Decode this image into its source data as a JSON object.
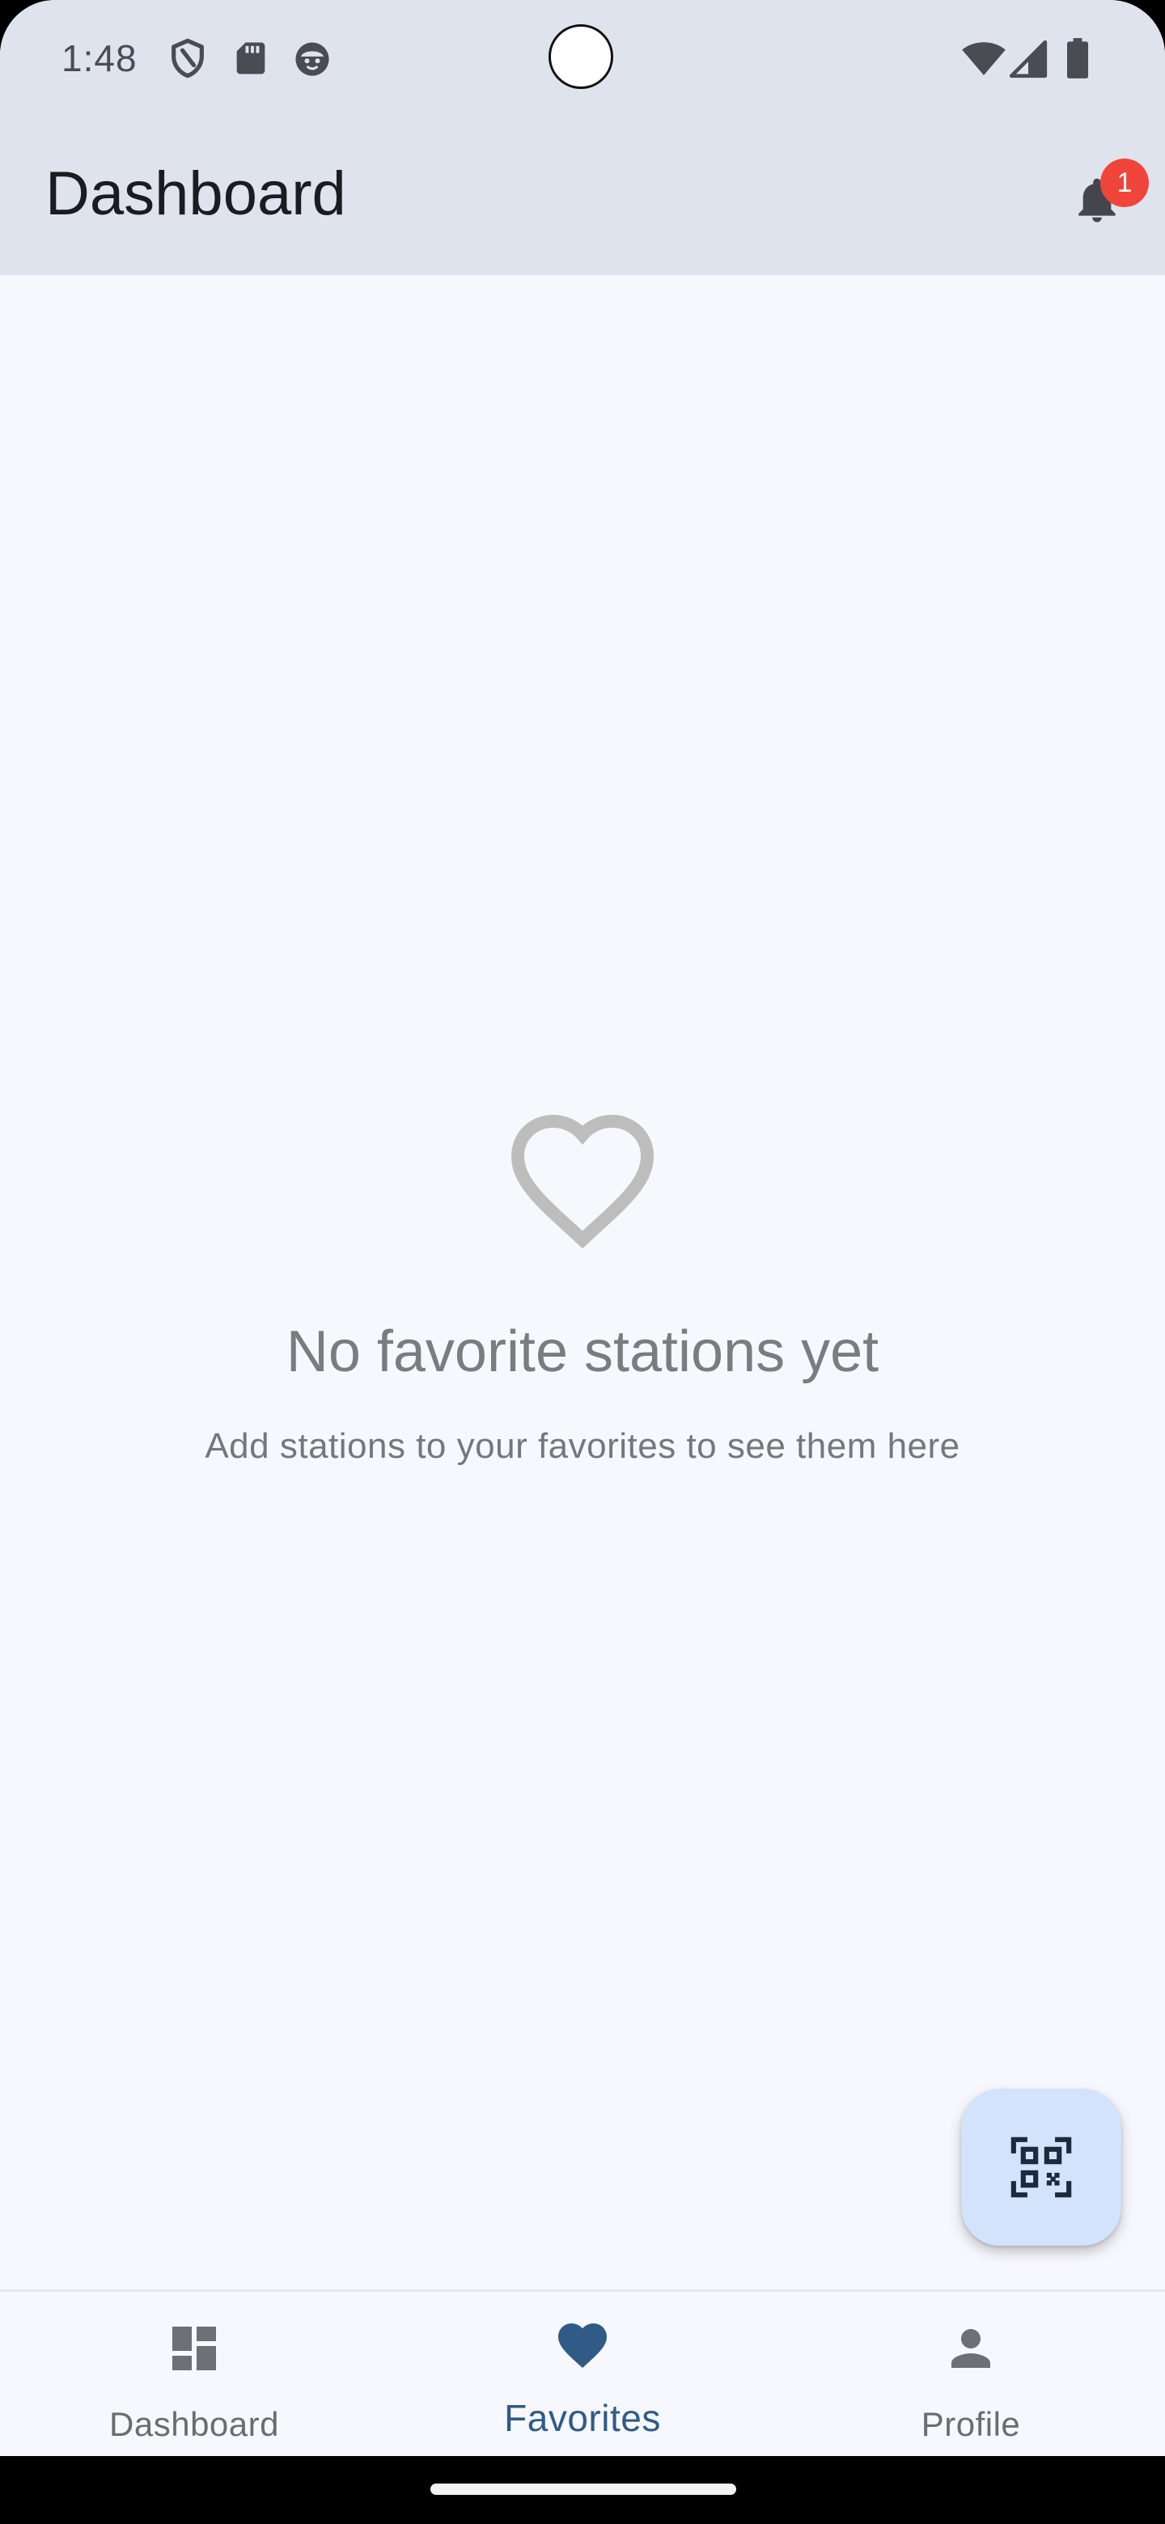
{
  "status_bar": {
    "time": "1:48",
    "left_icons": [
      "shield-icon",
      "sd-card-icon",
      "face-icon"
    ],
    "right_icons": [
      "wifi-icon",
      "cell-signal-icon",
      "battery-icon"
    ]
  },
  "app_bar": {
    "title": "Dashboard",
    "notification_icon": "bell-icon",
    "notification_count": "1"
  },
  "empty_state": {
    "icon": "heart-outline-icon",
    "title": "No favorite stations yet",
    "subtitle": "Add stations to your favorites to see them here"
  },
  "fab": {
    "icon": "qr-scanner-icon"
  },
  "bottom_nav": {
    "items": [
      {
        "label": "Dashboard",
        "icon": "dashboard-icon",
        "active": false
      },
      {
        "label": "Favorites",
        "icon": "heart-icon",
        "active": true
      },
      {
        "label": "Profile",
        "icon": "person-icon",
        "active": false
      }
    ]
  },
  "colors": {
    "app_bar_background": "#dfe3ee",
    "page_background": "#f7f8fd",
    "active_accent": "#2f5b86",
    "badge": "#f0453a",
    "fab_background": "#d2e3fb",
    "empty_icon": "#bdbdbd"
  }
}
